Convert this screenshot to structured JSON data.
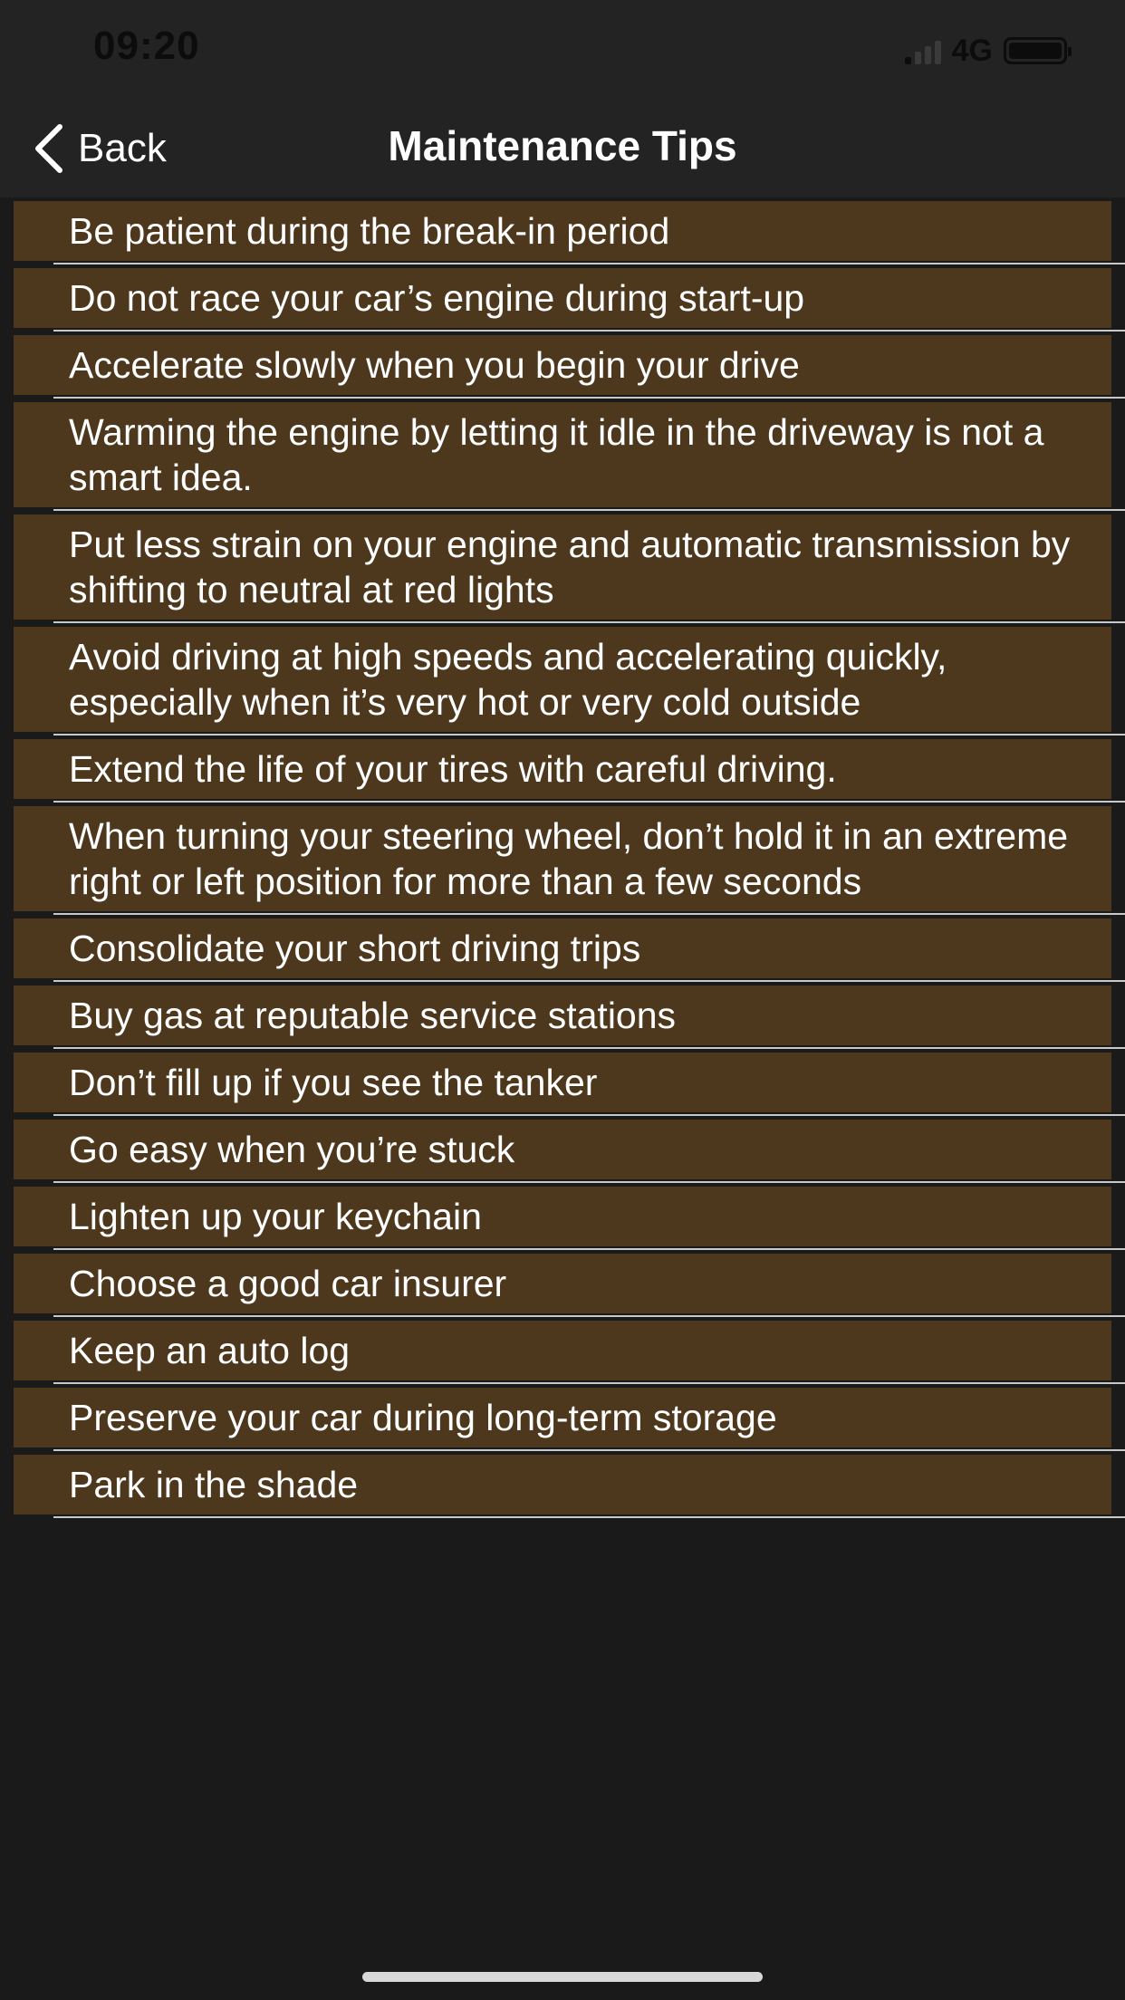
{
  "status_bar": {
    "time": "09:20",
    "network": "4G",
    "icons": [
      "signal-icon",
      "battery-icon"
    ]
  },
  "nav": {
    "back_label": "Back",
    "back_icon": "chevron-left-icon",
    "title": "Maintenance Tips"
  },
  "tips": [
    {
      "text": "Be patient during the break-in period"
    },
    {
      "text": "Do not race your car’s engine during start-up"
    },
    {
      "text": "Accelerate slowly when you begin your drive"
    },
    {
      "text": "Warming the engine by letting it idle in the driveway is not a smart idea."
    },
    {
      "text": "Put less strain on your engine and automatic transmission by shifting to neutral at red lights"
    },
    {
      "text": "Avoid driving at high speeds and accelerating quickly, especially when it’s very hot or very cold outside"
    },
    {
      "text": "Extend the life of your tires with careful driving."
    },
    {
      "text": "When turning your steering wheel, don’t hold it in an extreme right or left position for more than a few seconds"
    },
    {
      "text": "Consolidate your short driving trips"
    },
    {
      "text": "Buy gas at reputable service stations"
    },
    {
      "text": "Don’t fill up if you see the tanker"
    },
    {
      "text": "Go easy when you’re stuck"
    },
    {
      "text": "Lighten up your keychain"
    },
    {
      "text": "Choose a good car insurer"
    },
    {
      "text": "Keep an auto log"
    },
    {
      "text": "Preserve your car during long-term storage"
    },
    {
      "text": "Park in the shade"
    }
  ],
  "colors": {
    "background": "#1a1a1a",
    "bar": "#232323",
    "row": "#4d381d",
    "text": "#ffffff"
  }
}
